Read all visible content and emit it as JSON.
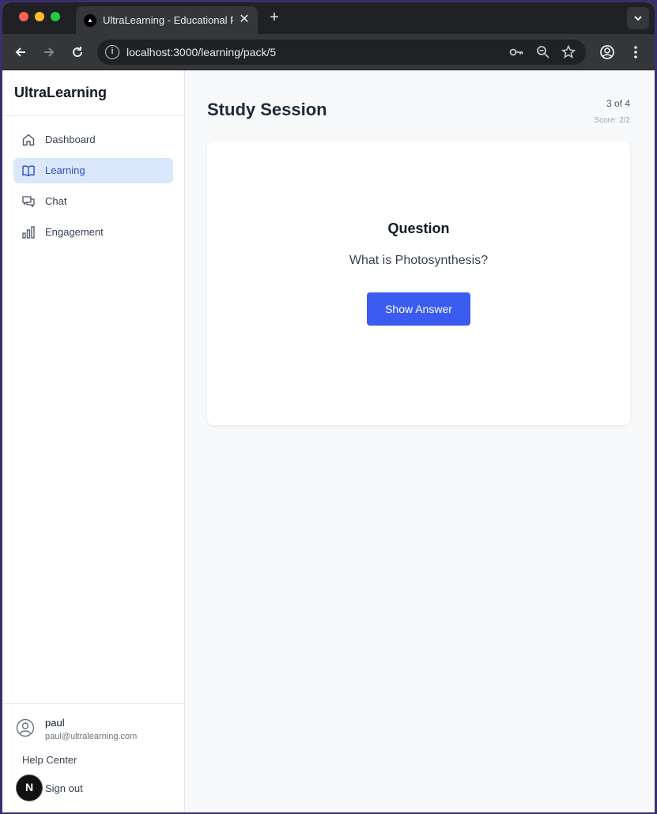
{
  "browser": {
    "tab_title": "UltraLearning - Educational P",
    "url": "localhost:3000/learning/pack/5",
    "new_tab": "+",
    "tab_close": "✕"
  },
  "sidebar": {
    "brand": "UltraLearning",
    "items": [
      {
        "label": "Dashboard",
        "icon": "home-icon",
        "active": false
      },
      {
        "label": "Learning",
        "icon": "book-icon",
        "active": true
      },
      {
        "label": "Chat",
        "icon": "chat-icon",
        "active": false
      },
      {
        "label": "Engagement",
        "icon": "bar-chart-icon",
        "active": false
      }
    ],
    "user": {
      "name": "paul",
      "email": "paul@ultralearning.com"
    },
    "help": "Help Center",
    "signout": "Sign out",
    "next_badge": "N"
  },
  "main": {
    "title": "Study Session",
    "progress": "3 of 4",
    "score": "Score: 2/2",
    "card": {
      "heading": "Question",
      "question": "What is Photosynthesis?",
      "button": "Show Answer"
    }
  },
  "colors": {
    "accent": "#3b5bf0",
    "active_nav_bg": "#dbe7fb",
    "active_nav_text": "#2f4fbf"
  }
}
